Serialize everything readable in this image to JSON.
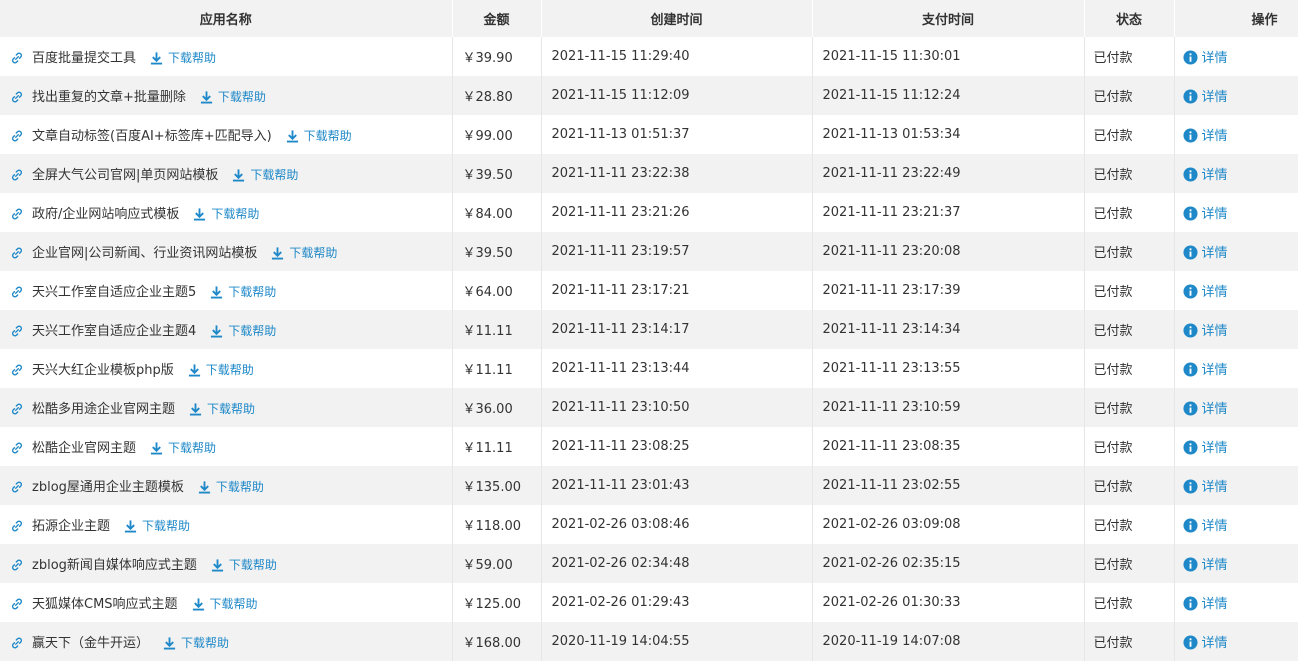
{
  "headers": {
    "name": "应用名称",
    "amount": "金额",
    "created": "创建时间",
    "paid": "支付时间",
    "status": "状态",
    "action": "操作"
  },
  "download_label": "下载帮助",
  "detail_label": "详情",
  "colors": {
    "accent": "#1e88c8",
    "stripe": "#f2f2f2",
    "text": "#333333"
  },
  "rows": [
    {
      "name": "百度批量提交工具",
      "amount": "￥39.90",
      "created": "2021-11-15 11:29:40",
      "paid": "2021-11-15 11:30:01",
      "status": "已付款"
    },
    {
      "name": "找出重复的文章+批量删除",
      "amount": "￥28.80",
      "created": "2021-11-15 11:12:09",
      "paid": "2021-11-15 11:12:24",
      "status": "已付款"
    },
    {
      "name": "文章自动标签(百度AI+标签库+匹配导入)",
      "amount": "￥99.00",
      "created": "2021-11-13 01:51:37",
      "paid": "2021-11-13 01:53:34",
      "status": "已付款"
    },
    {
      "name": "全屏大气公司官网|单页网站模板",
      "amount": "￥39.50",
      "created": "2021-11-11 23:22:38",
      "paid": "2021-11-11 23:22:49",
      "status": "已付款"
    },
    {
      "name": "政府/企业网站响应式模板",
      "amount": "￥84.00",
      "created": "2021-11-11 23:21:26",
      "paid": "2021-11-11 23:21:37",
      "status": "已付款"
    },
    {
      "name": "企业官网|公司新闻、行业资讯网站模板",
      "amount": "￥39.50",
      "created": "2021-11-11 23:19:57",
      "paid": "2021-11-11 23:20:08",
      "status": "已付款"
    },
    {
      "name": "天兴工作室自适应企业主题5",
      "amount": "￥64.00",
      "created": "2021-11-11 23:17:21",
      "paid": "2021-11-11 23:17:39",
      "status": "已付款"
    },
    {
      "name": "天兴工作室自适应企业主题4",
      "amount": "￥11.11",
      "created": "2021-11-11 23:14:17",
      "paid": "2021-11-11 23:14:34",
      "status": "已付款"
    },
    {
      "name": "天兴大红企业模板php版",
      "amount": "￥11.11",
      "created": "2021-11-11 23:13:44",
      "paid": "2021-11-11 23:13:55",
      "status": "已付款"
    },
    {
      "name": "松酷多用途企业官网主题",
      "amount": "￥36.00",
      "created": "2021-11-11 23:10:50",
      "paid": "2021-11-11 23:10:59",
      "status": "已付款"
    },
    {
      "name": "松酷企业官网主题",
      "amount": "￥11.11",
      "created": "2021-11-11 23:08:25",
      "paid": "2021-11-11 23:08:35",
      "status": "已付款"
    },
    {
      "name": "zblog屋通用企业主题模板",
      "amount": "￥135.00",
      "created": "2021-11-11 23:01:43",
      "paid": "2021-11-11 23:02:55",
      "status": "已付款"
    },
    {
      "name": "拓源企业主题",
      "amount": "￥118.00",
      "created": "2021-02-26 03:08:46",
      "paid": "2021-02-26 03:09:08",
      "status": "已付款"
    },
    {
      "name": "zblog新闻自媒体响应式主题",
      "amount": "￥59.00",
      "created": "2021-02-26 02:34:48",
      "paid": "2021-02-26 02:35:15",
      "status": "已付款"
    },
    {
      "name": "天狐媒体CMS响应式主题",
      "amount": "￥125.00",
      "created": "2021-02-26 01:29:43",
      "paid": "2021-02-26 01:30:33",
      "status": "已付款"
    },
    {
      "name": "赢天下（金牛开运）",
      "amount": "￥168.00",
      "created": "2020-11-19 14:04:55",
      "paid": "2020-11-19 14:07:08",
      "status": "已付款"
    }
  ]
}
